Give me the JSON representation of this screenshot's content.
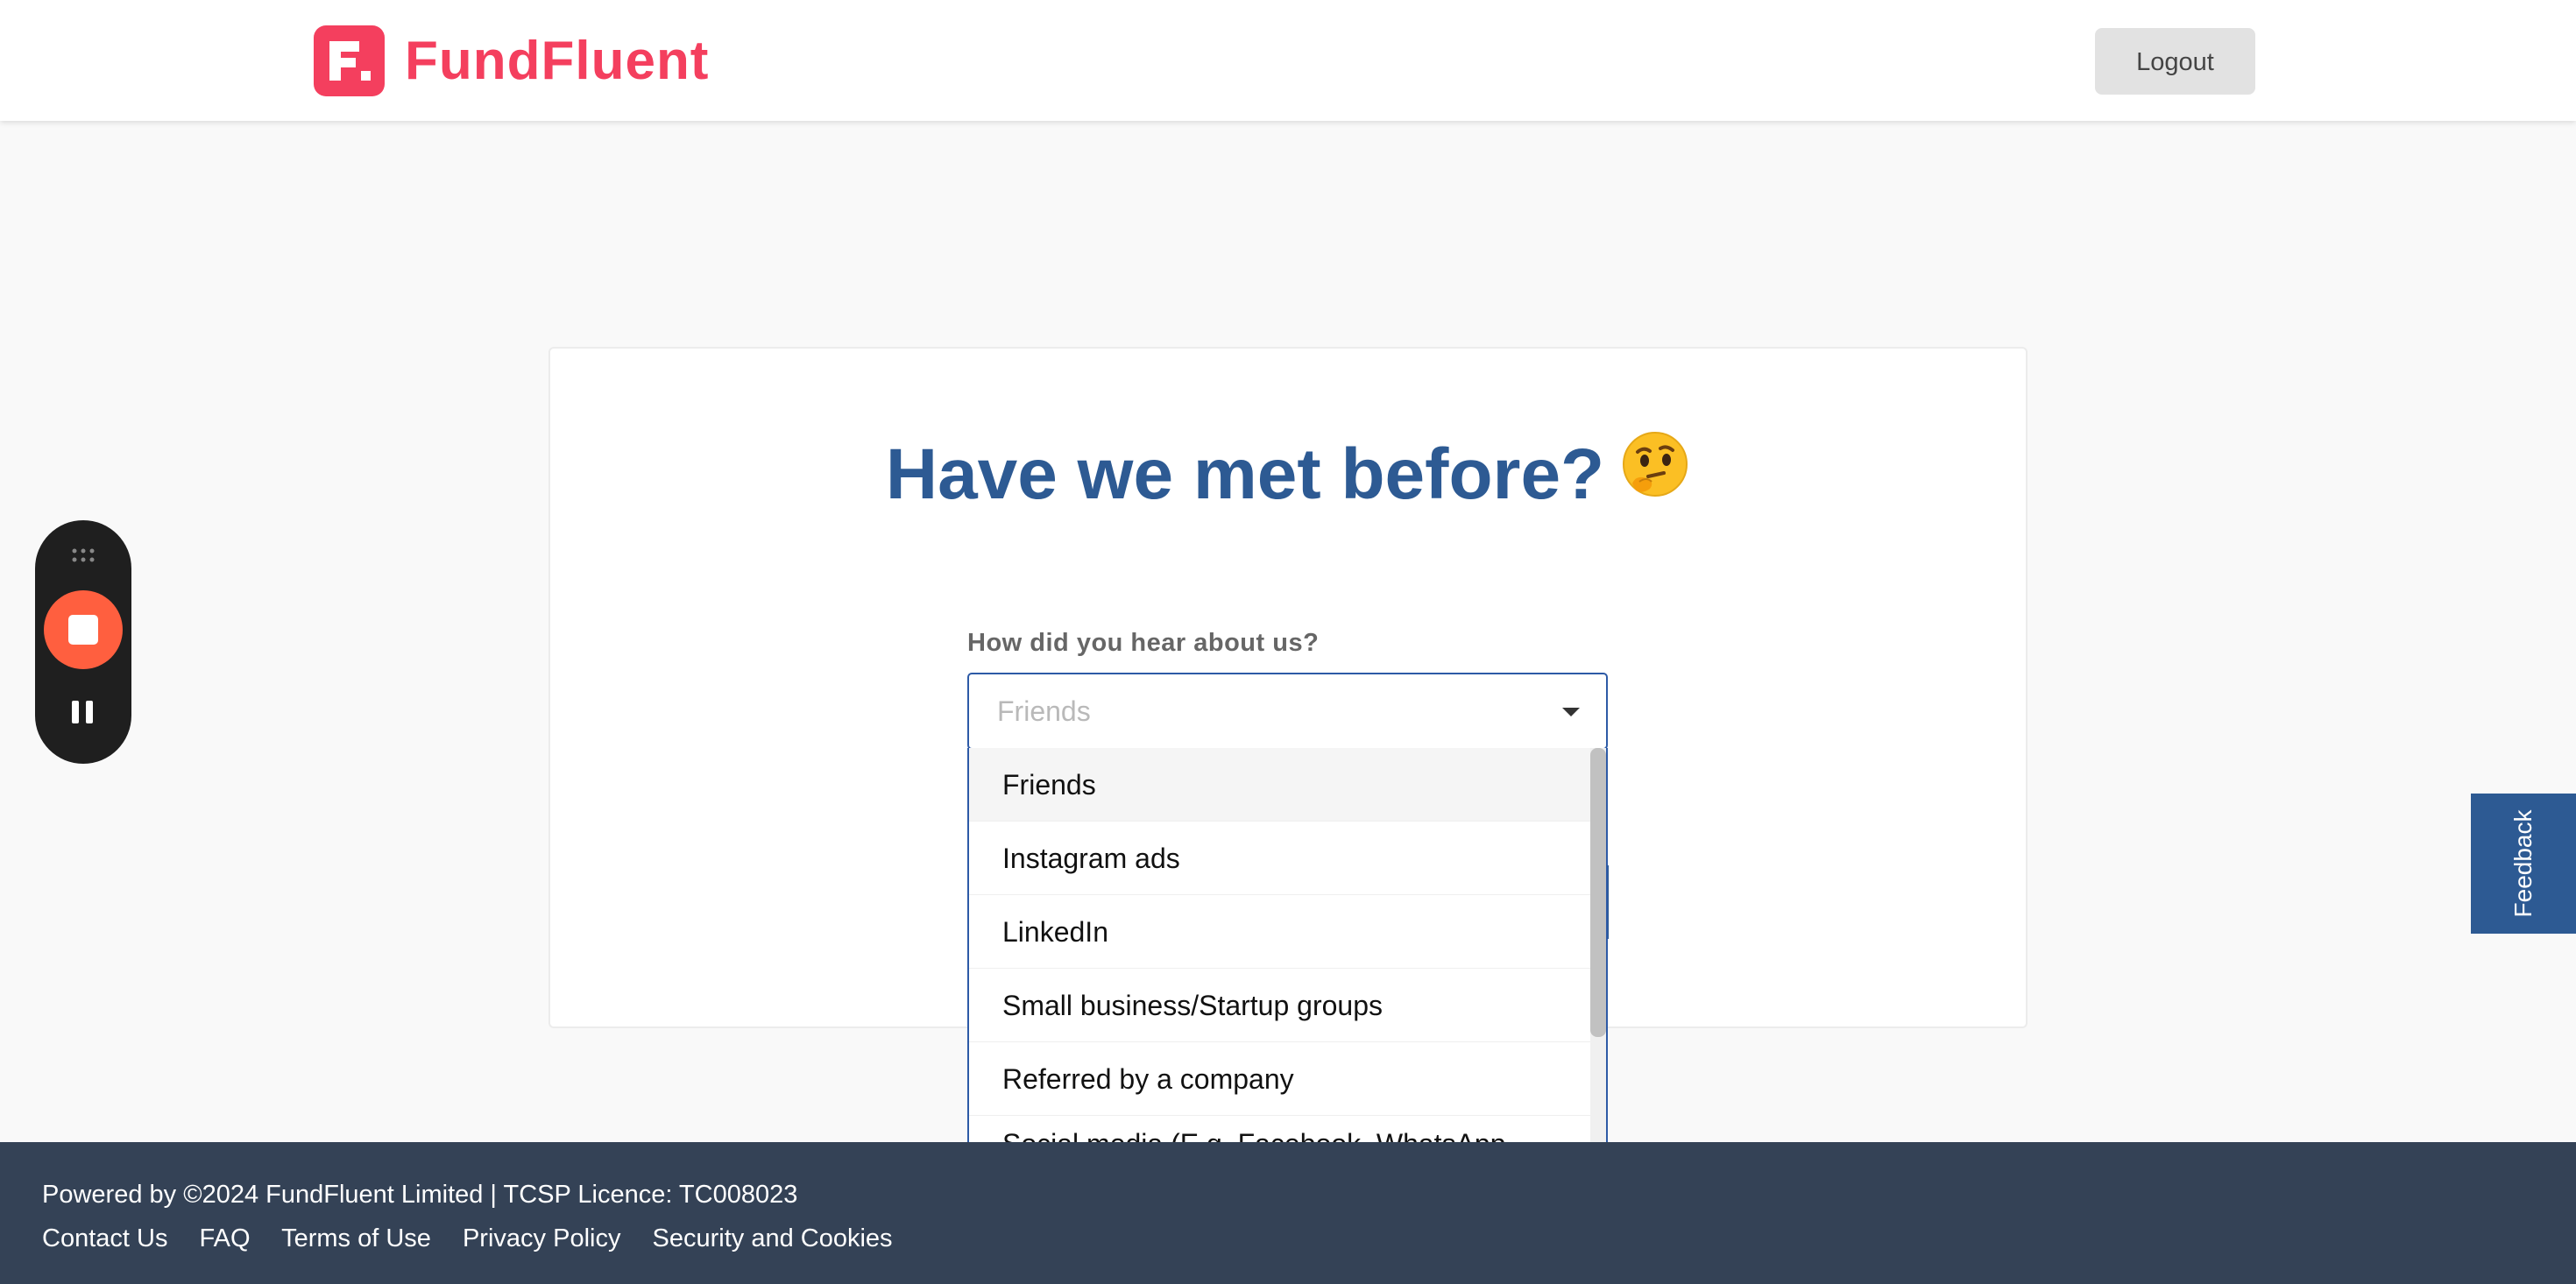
{
  "header": {
    "brand": "FundFluent",
    "logout_label": "Logout"
  },
  "main": {
    "title": "Have we met before?",
    "title_emoji": "thinking-face-emoji",
    "field_label": "How did you hear about us?",
    "select": {
      "selected_value": "Friends",
      "options": [
        "Friends",
        "Instagram ads",
        "LinkedIn",
        "Small business/Startup groups",
        "Referred by a company",
        "Social media (E.g. Facebook, WhatsApp, WeChat)"
      ]
    }
  },
  "feedback": {
    "label": "Feedback"
  },
  "footer": {
    "copyright": "Powered by ©2024 FundFluent Limited | TCSP Licence: TC008023",
    "links": [
      "Contact Us",
      "FAQ",
      "Terms of Use",
      "Privacy Policy",
      "Security and Cookies"
    ]
  },
  "recorder": {
    "icons": [
      "drag-handle-icon",
      "stop-icon",
      "pause-icon"
    ]
  },
  "colors": {
    "brand": "#f43f5e",
    "title": "#2d5a93",
    "footer_bg": "#344256",
    "focus_border": "#2d5aa6",
    "record_stop": "#ff5f3f"
  }
}
